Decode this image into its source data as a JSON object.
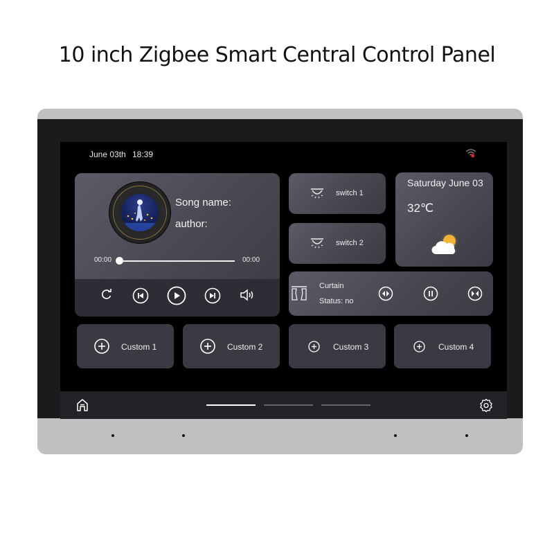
{
  "headline": "10 inch Zigbee Smart Central Control Panel",
  "status_bar": {
    "date": "June 03th",
    "time": "18:39",
    "wifi_icon": "wifi-disconnected-icon"
  },
  "music_player": {
    "song_label": "Song name:",
    "author_label": "author:",
    "elapsed": "00:00",
    "duration": "00:00",
    "progress": 0,
    "controls": [
      {
        "name": "repeat",
        "icon": "repeat-icon"
      },
      {
        "name": "previous",
        "icon": "skip-previous-icon"
      },
      {
        "name": "play",
        "icon": "play-icon"
      },
      {
        "name": "next",
        "icon": "skip-next-icon"
      },
      {
        "name": "volume",
        "icon": "volume-icon"
      }
    ]
  },
  "switches": [
    {
      "label": "switch 1",
      "icon": "ceiling-light-icon"
    },
    {
      "label": "switch 2",
      "icon": "ceiling-light-icon"
    }
  ],
  "weather": {
    "date": "Saturday June 03",
    "temperature": "32℃",
    "condition_icon": "partly-cloudy-icon",
    "colors": {
      "sun": "#f2b437",
      "cloud": "#ffffff"
    }
  },
  "curtain": {
    "name": "Curtain",
    "status": "Status: no",
    "controls": [
      {
        "name": "open",
        "icon": "curtain-open-icon"
      },
      {
        "name": "pause",
        "icon": "pause-icon"
      },
      {
        "name": "close",
        "icon": "curtain-close-icon"
      }
    ]
  },
  "customs": [
    {
      "label": "Custom 1"
    },
    {
      "label": "Custom 2"
    },
    {
      "label": "Custom 3"
    },
    {
      "label": "Custom 4"
    }
  ],
  "navbar": {
    "home_icon": "home-icon",
    "settings_icon": "gear-icon",
    "pages": 3,
    "active_page": 1
  },
  "colors": {
    "screen_bg": "#000000",
    "card": "#4d4c55",
    "card_dark": "#2d2d36",
    "navbar": "#222327",
    "frame": "#c0c0c0",
    "bezel": "#1b1b1b",
    "status_alert": "#e02b2b"
  }
}
